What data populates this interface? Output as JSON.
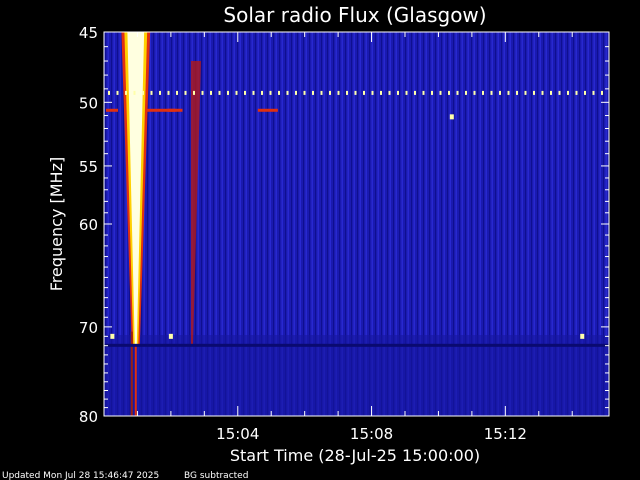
{
  "chart_data": {
    "type": "heatmap",
    "title": "Solar radio Flux (Glasgow)",
    "xlabel": "Start Time (28-Jul-25 15:00:00)",
    "ylabel": "Frequency [MHz]",
    "x_range_minutes": [
      0,
      15.1
    ],
    "y_range_mhz": [
      45,
      80
    ],
    "x_ticks": [
      {
        "minute": 4,
        "label": "15:04"
      },
      {
        "minute": 8,
        "label": "15:08"
      },
      {
        "minute": 12,
        "label": "15:12"
      }
    ],
    "y_ticks": [
      {
        "mhz": 45,
        "label": "45"
      },
      {
        "mhz": 50,
        "label": "50"
      },
      {
        "mhz": 55,
        "label": "55"
      },
      {
        "mhz": 60,
        "label": "60"
      },
      {
        "mhz": 70,
        "label": "70"
      },
      {
        "mhz": 80,
        "label": "80"
      }
    ],
    "colors": {
      "background": "#1a1ab0",
      "burst_core": "#ffffe0",
      "burst_hot": "#ffd000",
      "burst_warm": "#e03010",
      "interference": "#ffffaa",
      "frame": "#ffffff"
    },
    "features": [
      {
        "name": "Type III burst",
        "minute_start": 0.7,
        "minute_end": 1.2,
        "mhz_low": 45,
        "mhz_high": 80
      },
      {
        "name": "Weak drifting burst",
        "minute_start": 2.6,
        "minute_end": 2.9,
        "mhz_low": 47,
        "mhz_high": 72
      },
      {
        "name": "RFI line",
        "mhz": 49.3
      },
      {
        "name": "RFI line",
        "mhz": 50.6
      },
      {
        "name": "RFI line",
        "mhz": 71.8
      }
    ]
  },
  "footer": {
    "updated": "Updated Mon Jul 28 15:46:47 2025",
    "note": "BG subtracted"
  }
}
